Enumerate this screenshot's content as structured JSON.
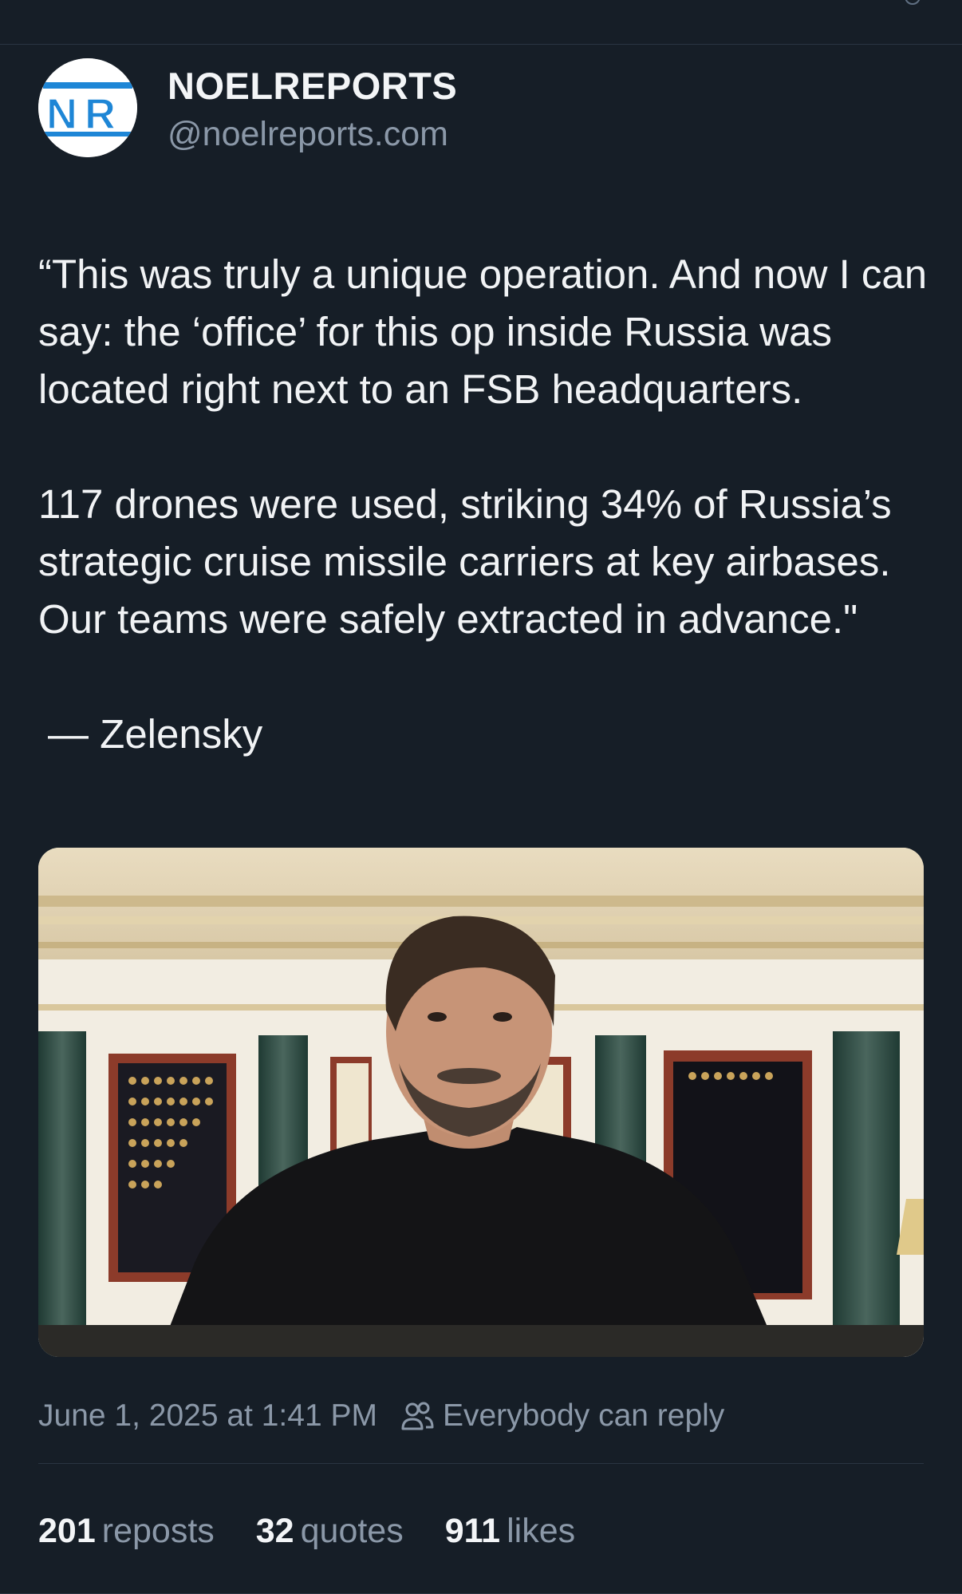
{
  "colors": {
    "background": "#161e27",
    "text_primary": "#f1f3f5",
    "text_secondary": "#8b98a8",
    "divider": "#2a3542",
    "brand_blue": "#1e86d6"
  },
  "post": {
    "author": {
      "display_name": "NOELREPORTS",
      "handle": "@noelreports.com",
      "avatar_monogram": "NR",
      "avatar_icon": "noelreports-logo-icon"
    },
    "flag_icon": "ukraine-flag-icon",
    "text": {
      "paragraph1": "“This was truly a unique operation. And now I can say: the ‘office’ for this op inside Russia was located right next to an FSB headquarters.",
      "paragraph2": "117 drones were used, striking 34% of Russia’s strategic cruise missile carriers at key airbases. Our teams were safely extracted in advance.\"",
      "attribution": "— Zelensky"
    },
    "media": {
      "type": "video-still"
    },
    "timestamp": "June 1, 2025 at 1:41 PM",
    "reply_setting": "Everybody can reply",
    "reply_icon": "people-icon",
    "stats": {
      "reposts_count": "201",
      "reposts_label": "reposts",
      "quotes_count": "32",
      "quotes_label": "quotes",
      "likes_count": "911",
      "likes_label": "likes"
    }
  }
}
